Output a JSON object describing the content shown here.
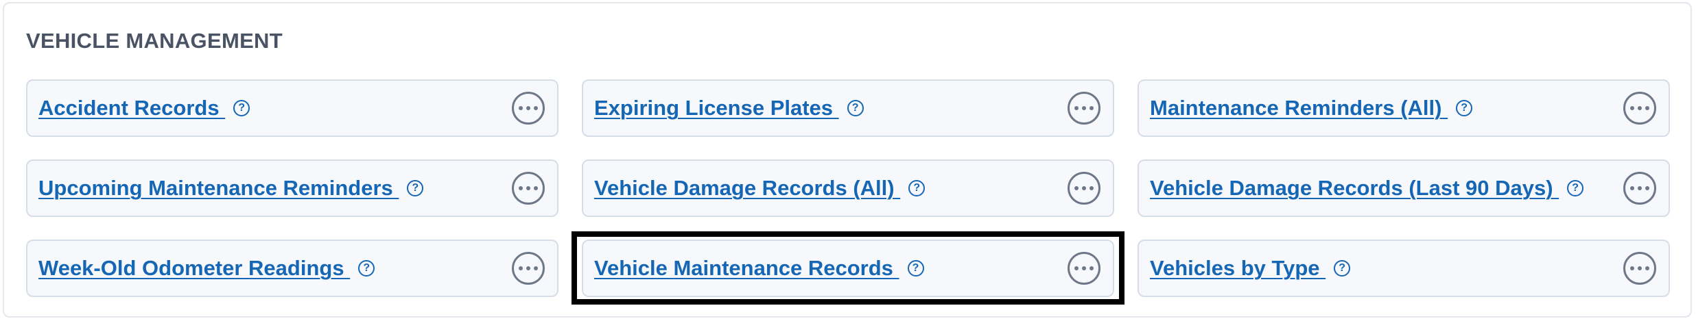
{
  "section": {
    "title": "VEHICLE MANAGEMENT"
  },
  "icons": {
    "help": "help-circle-icon",
    "more": "more-horizontal-icon"
  },
  "colors": {
    "link": "#1566b4",
    "card_background": "#f6f8fb",
    "card_border": "#d6dde7",
    "title": "#4a5363",
    "icon_gray": "#6d7788",
    "highlight": "#000000"
  },
  "reports": [
    {
      "label": "Accident Records ",
      "help": "?"
    },
    {
      "label": "Expiring License Plates ",
      "help": "?"
    },
    {
      "label": "Maintenance Reminders (All) ",
      "help": "?"
    },
    {
      "label": "Upcoming Maintenance Reminders ",
      "help": "?"
    },
    {
      "label": "Vehicle Damage Records (All) ",
      "help": "?"
    },
    {
      "label": "Vehicle Damage Records (Last 90 Days) ",
      "help": "?"
    },
    {
      "label": "Week-Old Odometer Readings ",
      "help": "?"
    },
    {
      "label": "Vehicle Maintenance Records ",
      "help": "?",
      "highlighted": true
    },
    {
      "label": "Vehicles by Type ",
      "help": "?"
    }
  ]
}
